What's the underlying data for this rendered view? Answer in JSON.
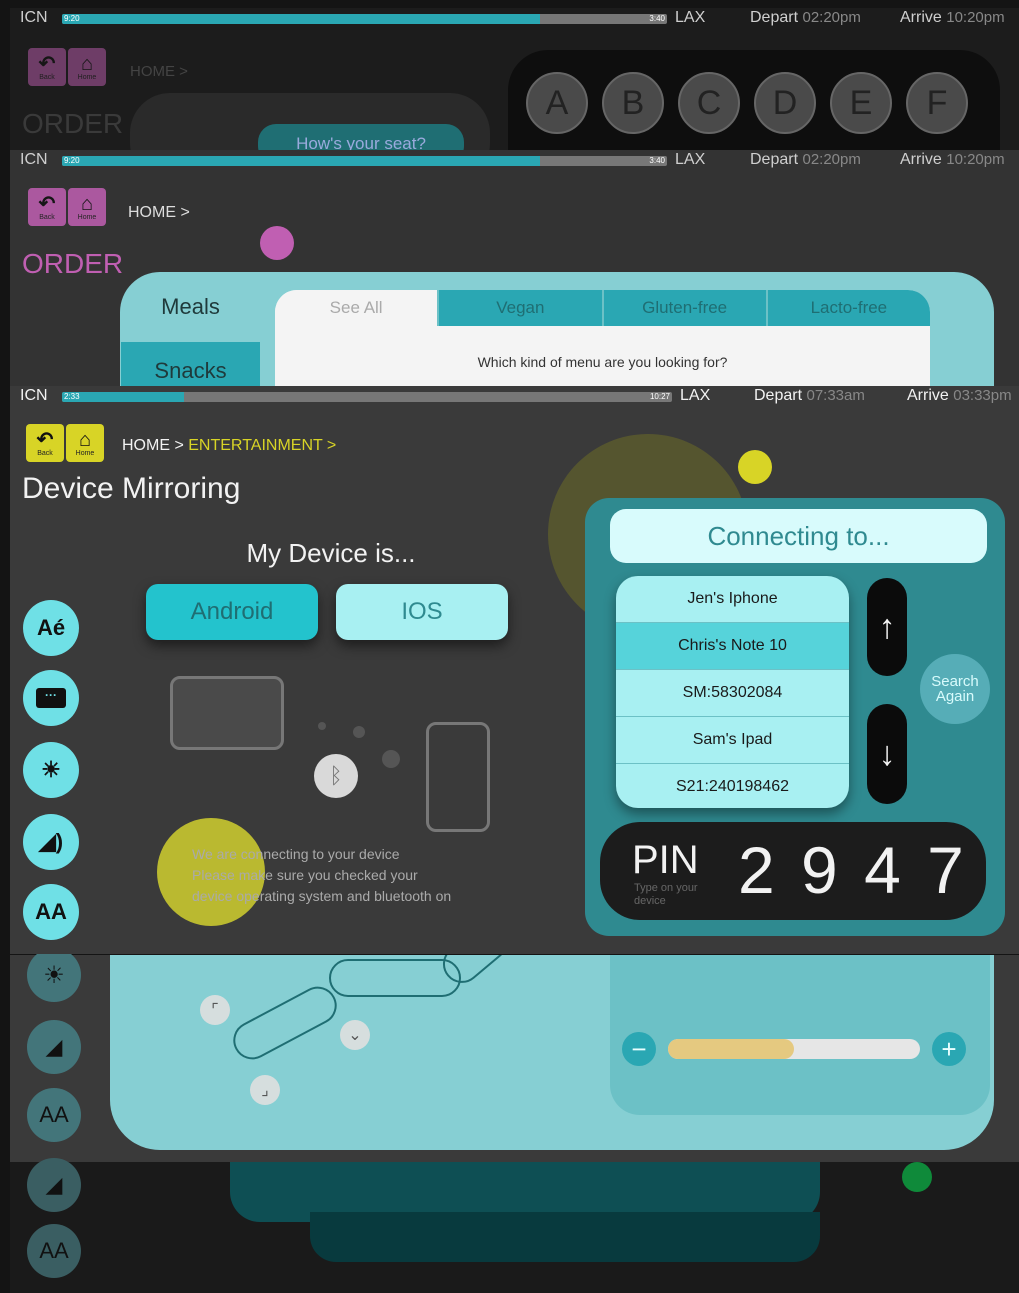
{
  "flight": {
    "origin": "ICN",
    "destination": "LAX",
    "depart_label": "Depart",
    "arrive_label": "Arrive",
    "layers": [
      {
        "elapsed": "9:20",
        "remaining": "3:40",
        "progress": 0.79,
        "depart": "02:20pm",
        "arrive": "10:20pm"
      },
      {
        "elapsed": "9:20",
        "remaining": "3:40",
        "progress": 0.79,
        "depart": "02:20pm",
        "arrive": "10:20pm"
      },
      {
        "elapsed": "2:33",
        "remaining": "10:27",
        "progress": 0.2,
        "depart": "07:33am",
        "arrive": "03:33pm"
      }
    ]
  },
  "nav": {
    "back_label": "Back",
    "home_label": "Home"
  },
  "layer1": {
    "crumb": "HOME >",
    "title": "ORDER",
    "chat_bubble": "How's your seat?",
    "letters": [
      "A",
      "B",
      "C",
      "D",
      "E",
      "F"
    ]
  },
  "layer2": {
    "crumb": "HOME >",
    "title": "ORDER",
    "categories": [
      "Meals",
      "Snacks"
    ],
    "filters": [
      "See All",
      "Vegan",
      "Gluten-free",
      "Lacto-free"
    ],
    "question": "Which kind of menu are you looking for?"
  },
  "layer3": {
    "crumb_home": "HOME >",
    "crumb_section": "ENTERTAINMENT >",
    "title": "Device Mirroring",
    "my_device_label": "My Device is...",
    "os_options": [
      "Android",
      "IOS"
    ],
    "selected_os": "Android",
    "status_message": "We are connecting to your device\nPlease make sure you checked your\ndevice operating system and bluetooth on",
    "connecting_label": "Connecting to...",
    "devices": [
      "Jen's Iphone",
      "Chris's Note 10",
      "SM:58302084",
      "Sam's Ipad",
      "S21:240198462"
    ],
    "selected_device": "Chris's Note 10",
    "search_again": "Search Again",
    "pin_label": "PIN",
    "pin_hint": "Type on your device",
    "pin_value": "2 9 4 7"
  },
  "colors": {
    "accent_teal": "#2cc6d0",
    "light_teal": "#a8f0f2",
    "brand_yellow": "#d8d426",
    "panel_teal": "#2f8a90",
    "order_pink": "#c05fb2"
  },
  "icons": [
    "back-icon",
    "home-icon",
    "translate-icon",
    "subtitle-icon",
    "brightness-icon",
    "volume-icon",
    "font-size-icon",
    "bluetooth-icon",
    "arrow-up-icon",
    "arrow-down-icon",
    "minus-icon",
    "plus-icon"
  ]
}
